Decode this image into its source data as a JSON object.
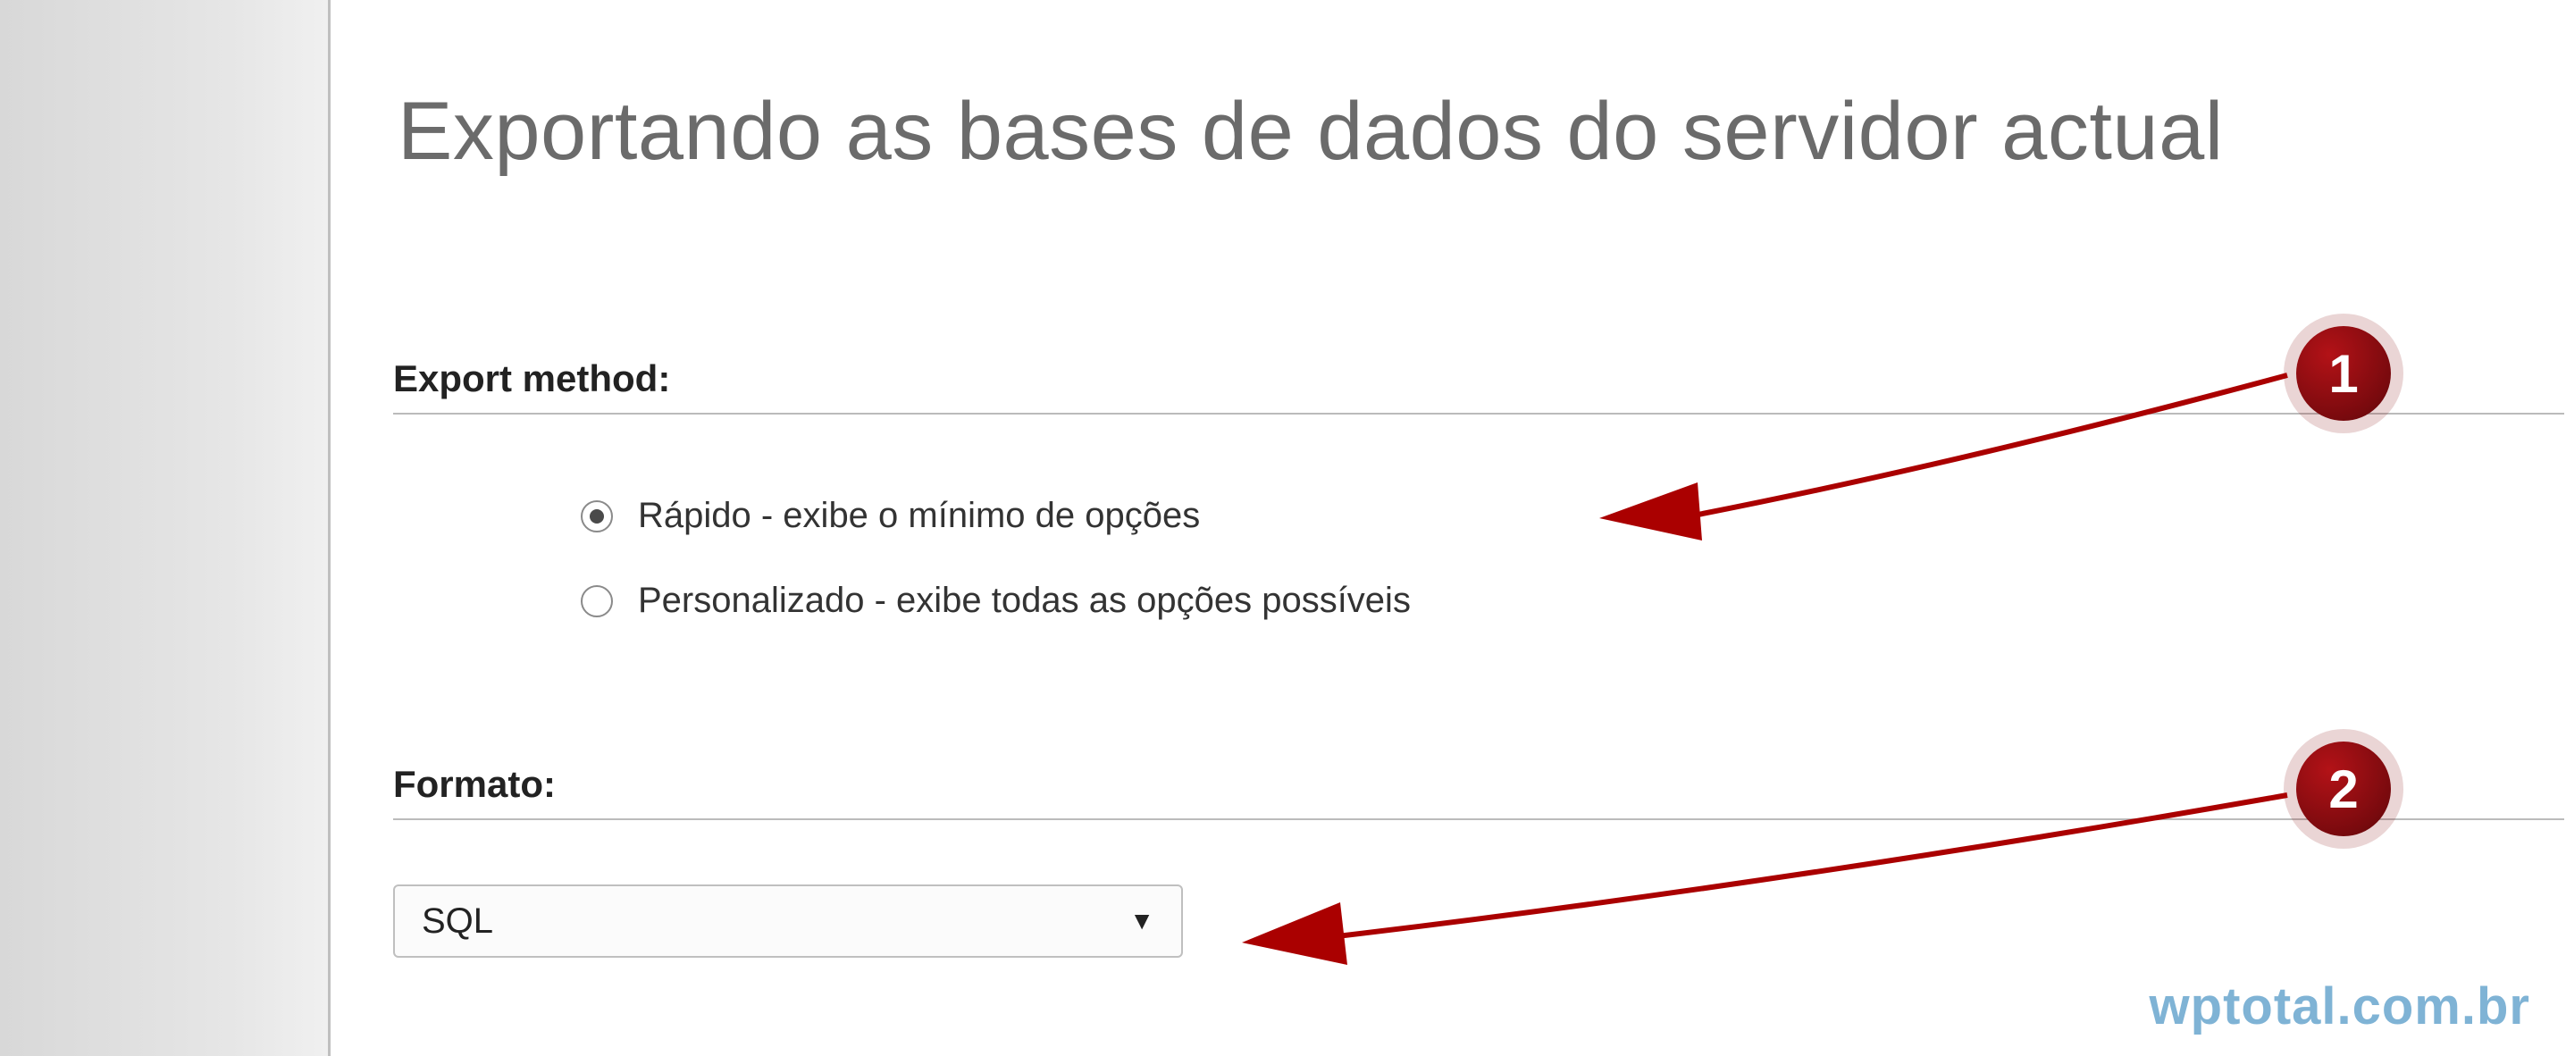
{
  "page": {
    "title": "Exportando as bases de dados do servidor actual"
  },
  "sections": {
    "export_method": {
      "label": "Export method:"
    },
    "formato": {
      "label": "Formato:"
    }
  },
  "radios": {
    "rapido": {
      "label": "Rápido - exibe o mínimo de opções",
      "selected": true
    },
    "personalizado": {
      "label": "Personalizado - exibe todas as opções possíveis",
      "selected": false
    }
  },
  "format_select": {
    "value": "SQL"
  },
  "annotations": {
    "badge1": "1",
    "badge2": "2"
  },
  "watermark": "wptotal.com.br"
}
